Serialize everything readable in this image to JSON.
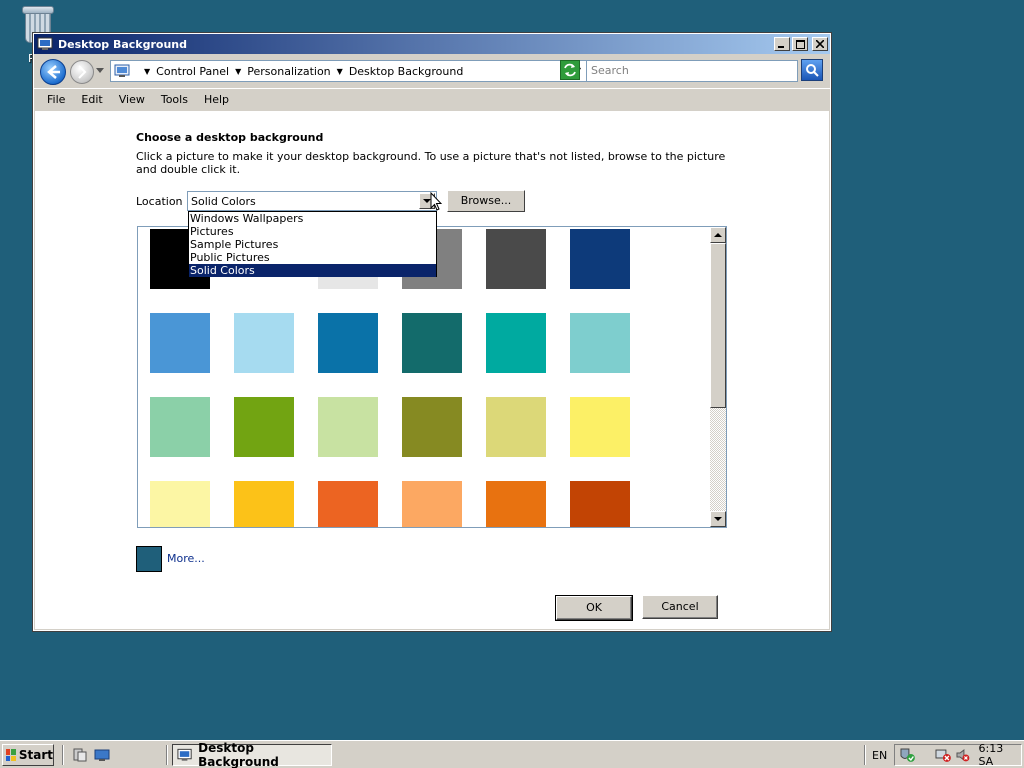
{
  "desktop": {
    "recycle_label": "Rec"
  },
  "window": {
    "title": "Desktop Background",
    "controls": [
      "minimize",
      "maximize",
      "close"
    ]
  },
  "nav": {
    "breadcrumb": [
      "Control Panel",
      "Personalization",
      "Desktop Background"
    ],
    "search_placeholder": "Search"
  },
  "menu": [
    "File",
    "Edit",
    "View",
    "Tools",
    "Help"
  ],
  "main": {
    "heading": "Choose a desktop background",
    "description": "Click a picture to make it your desktop background. To use a picture that's not listed, browse to the picture and double click it.",
    "location_label": "Location",
    "location_value": "Solid Colors",
    "browse_label": "Browse...",
    "dropdown_options": [
      "Windows Wallpapers",
      "Pictures",
      "Sample Pictures",
      "Public Pictures",
      "Solid Colors"
    ],
    "dropdown_selected_index": 4,
    "swatch_colors": [
      [
        "#000000",
        "#ffffff",
        "#e6e6e6",
        "#808080",
        "#4a4a4a",
        "#0d3a7a"
      ],
      [
        "#4a96d6",
        "#a6dbf0",
        "#0a72a8",
        "#136b6b",
        "#00aaa0",
        "#7ecece"
      ],
      [
        "#8bd0a8",
        "#72a412",
        "#c8e2a2",
        "#868a22",
        "#dcd878",
        "#fcf066"
      ],
      [
        "#fcf6a4",
        "#fcc218",
        "#ec6422",
        "#fca862",
        "#e87210",
        "#c24404"
      ]
    ],
    "more_swatch_color": "#1f5f7a",
    "more_label": "More...",
    "ok_label": "OK",
    "cancel_label": "Cancel"
  },
  "taskbar": {
    "start_label": "Start",
    "task_label": "Desktop Background",
    "language": "EN",
    "clock": "6:13 SA"
  }
}
